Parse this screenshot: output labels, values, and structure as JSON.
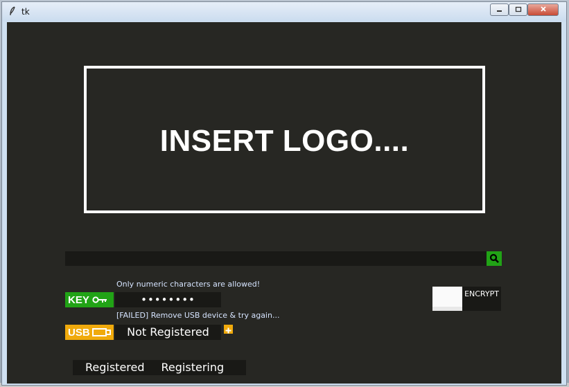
{
  "window": {
    "title": "tk",
    "icon": "feather-icon"
  },
  "window_controls": {
    "minimize_icon": "minimize-icon",
    "maximize_icon": "maximize-icon",
    "close_icon": "close-icon"
  },
  "logo": {
    "text": "INSERT LOGO...."
  },
  "search": {
    "value": "",
    "icon": "search-icon"
  },
  "key": {
    "hint": "Only numeric characters are allowed!",
    "label": "KEY",
    "icon": "key-icon",
    "value": "••••••••"
  },
  "usb": {
    "failed_message": "[FAILED] Remove USB device & try again...",
    "label": "USB",
    "icon": "usb-icon",
    "status": "Not Registered",
    "add_icon": "plus-icon"
  },
  "encrypt": {
    "label": "ENCRYPT"
  },
  "tabs": [
    "Registered",
    "Registering"
  ],
  "colors": {
    "background": "#272723",
    "field": "#191916",
    "green": "#21a316",
    "yellow": "#f0aa0c",
    "white": "#ffffff",
    "hint_text": "#d6e4ff"
  }
}
